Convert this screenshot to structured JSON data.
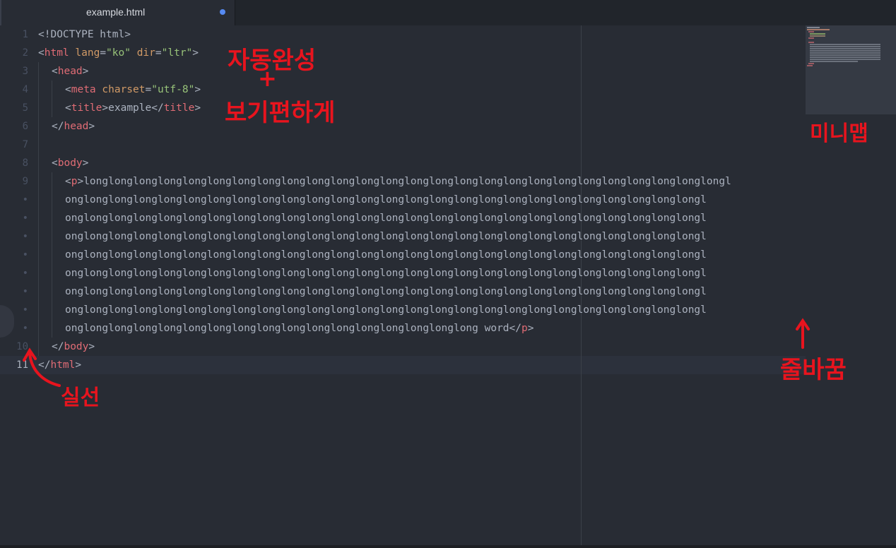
{
  "tab": {
    "title": "example.html",
    "modified": true
  },
  "gutter": [
    "1",
    "2",
    "3",
    "4",
    "5",
    "6",
    "7",
    "8",
    "9",
    "•",
    "•",
    "•",
    "•",
    "•",
    "•",
    "•",
    "•",
    "10",
    "11"
  ],
  "current_line": "11",
  "code": {
    "l1": "<!DOCTYPE html>",
    "l2_tag": "html",
    "l2_attr1": "lang",
    "l2_val1": "\"ko\"",
    "l2_attr2": "dir",
    "l2_val2": "\"ltr\"",
    "l3_tag": "head",
    "l4_tag": "meta",
    "l4_attr": "charset",
    "l4_val": "\"utf-8\"",
    "l5_tag": "title",
    "l5_text": "example",
    "l6_tag": "head",
    "l8_tag": "body",
    "l9_tag": "p",
    "l9_text": "longlonglonglonglonglonglonglonglonglonglonglonglonglonglonglonglonglonglonglonglonglonglonglonglonglongl",
    "wrap_line": "onglonglonglonglonglonglonglonglonglonglonglonglonglonglonglonglonglonglonglonglonglonglonglonglonglongl",
    "last_text": "onglonglonglonglonglonglonglonglonglonglonglonglonglonglonglonglong word",
    "last_tag": "p",
    "l10_tag": "body",
    "l11_tag": "html"
  },
  "annotations": {
    "autocomplete": "자동완성",
    "plus": "+",
    "readable": "보기편하게",
    "minimap": "미니맵",
    "word_wrap": "줄바꿈",
    "guide_line": "실선"
  },
  "colors": {
    "tag": "#e06c75",
    "attr": "#d19a66",
    "string": "#98c379",
    "text": "#abb2bf",
    "annotation": "#e8141e",
    "accent_dot": "#568af2"
  }
}
